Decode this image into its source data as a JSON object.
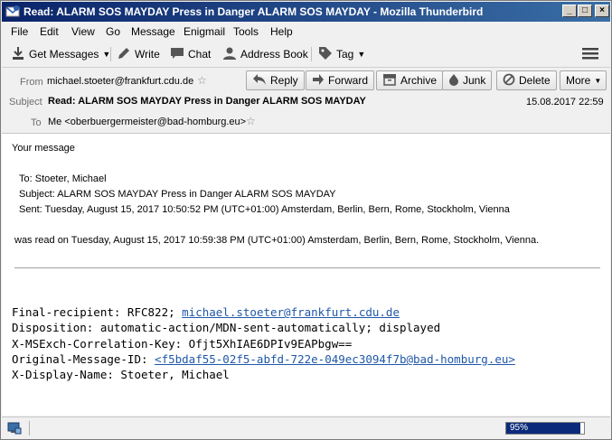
{
  "window": {
    "title": "Read: ALARM SOS MAYDAY Press in Danger ALARM SOS MAYDAY - Mozilla Thunderbird"
  },
  "menu": [
    "File",
    "Edit",
    "View",
    "Go",
    "Message",
    "Enigmail",
    "Tools",
    "Help"
  ],
  "toolbar": {
    "get_messages": "Get Messages",
    "write": "Write",
    "chat": "Chat",
    "address_book": "Address Book",
    "tag": "Tag"
  },
  "header": {
    "from_label": "From",
    "from_value": "michael.stoeter@frankfurt.cdu.de",
    "subject_label": "Subject",
    "subject_value": "Read: ALARM SOS MAYDAY Press in Danger ALARM SOS MAYDAY",
    "to_label": "To",
    "to_value": "Me <oberbuergermeister@bad-homburg.eu>",
    "date": "15.08.2017 22:59",
    "buttons": {
      "reply": "Reply",
      "forward": "Forward",
      "archive": "Archive",
      "junk": "Junk",
      "delete": "Delete",
      "more": "More"
    }
  },
  "body": {
    "intro": "Your message",
    "to_line": "To: Stoeter, Michael",
    "subject_line": "Subject: ALARM SOS MAYDAY Press in Danger ALARM SOS MAYDAY",
    "sent_line": "Sent: Tuesday, August 15, 2017 10:50:52 PM (UTC+01:00) Amsterdam, Berlin, Bern, Rome, Stockholm, Vienna",
    "read_line": "was read on Tuesday, August 15, 2017 10:59:38 PM (UTC+01:00) Amsterdam, Berlin, Bern, Rome, Stockholm, Vienna.",
    "final_recipient_prefix": "Final-recipient: RFC822; ",
    "final_recipient_link": "michael.stoeter@frankfurt.cdu.de",
    "disposition": "Disposition: automatic-action/MDN-sent-automatically; displayed",
    "correlation": "X-MSExch-Correlation-Key: Ofjt5XhIAE6DPIv9EAPbgw==",
    "orig_id_prefix": "Original-Message-ID: ",
    "orig_id_link": "<f5bdaf55-02f5-abfd-722e-049ec3094f7b@bad-homburg.eu>",
    "display_name": "X-Display-Name: Stoeter, Michael"
  },
  "status": {
    "progress_text": "95%",
    "progress_value": 0.95
  },
  "colors": {
    "titlebar": "#0a246a",
    "link": "#1f58a8",
    "progress": "#0b2a7a"
  }
}
